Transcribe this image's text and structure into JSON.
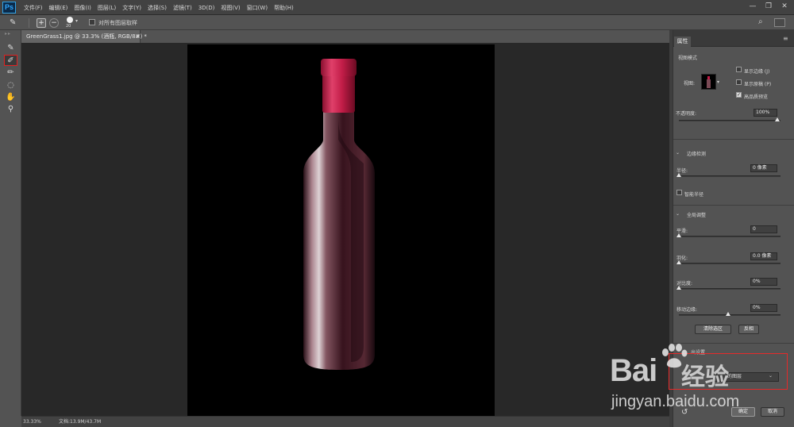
{
  "app": {
    "logo": "Ps",
    "logo_color": "#31A8FF"
  },
  "menu": [
    "文件(F)",
    "编辑(E)",
    "图像(I)",
    "图层(L)",
    "文字(Y)",
    "选择(S)",
    "滤镜(T)",
    "3D(D)",
    "视图(V)",
    "窗口(W)",
    "帮助(H)"
  ],
  "window_controls": {
    "minimize": "—",
    "maximize": "❐",
    "close": "✕"
  },
  "options": {
    "brush_size": "20",
    "sample_all_layers_label": "对所有图层取样",
    "sample_all_layers_checked": false
  },
  "document": {
    "tab_title": "GreenGrass1.jpg @ 33.3% (酒瓶, RGB/8#) *",
    "close": "×",
    "zoom": "33.33%",
    "doc_info": "文档:13.9M/43.7M"
  },
  "tools": [
    "quick-selection-icon",
    "refine-edge-brush-icon",
    "brush-icon",
    "lasso-icon",
    "hand-icon",
    "zoom-icon"
  ],
  "panel": {
    "tab": "属性",
    "view_mode": {
      "title": "视图模式",
      "view_label": "视图:",
      "show_edge": "显示边缘 (J)",
      "show_edge_checked": false,
      "show_original": "显示原稿 (P)",
      "show_original_checked": false,
      "hq_preview": "高品质预览",
      "hq_preview_checked": true
    },
    "opacity": {
      "label": "不透明度:",
      "value": "100%",
      "level": 1.0
    },
    "edge_detection": {
      "title": "边缘检测",
      "radius_label": "半径:",
      "radius_value": "0 像素",
      "radius_level": 0.0,
      "smart_radius": "智能半径",
      "smart_radius_checked": false
    },
    "global_refinements": {
      "title": "全局调整",
      "smooth_label": "平滑:",
      "smooth_value": "0",
      "smooth_level": 0.0,
      "feather_label": "羽化:",
      "feather_value": "0.0 像素",
      "feather_level": 0.0,
      "contrast_label": "对比度:",
      "contrast_value": "0%",
      "contrast_level": 0.0,
      "shift_edge_label": "移动边缘:",
      "shift_edge_value": "0%",
      "shift_edge_level": 0.5,
      "clear_selection": "清除选区",
      "invert": "反相"
    },
    "output": {
      "title": "出设置",
      "select_value": "的图层"
    },
    "ok": "确定",
    "cancel": "取消"
  },
  "colors": {
    "highlight": "#E52A2A",
    "accent": "#31A8FF"
  },
  "watermark": {
    "brand_latin": "Bai",
    "brand_cn": "经验",
    "url": "jingyan.baidu.com"
  }
}
